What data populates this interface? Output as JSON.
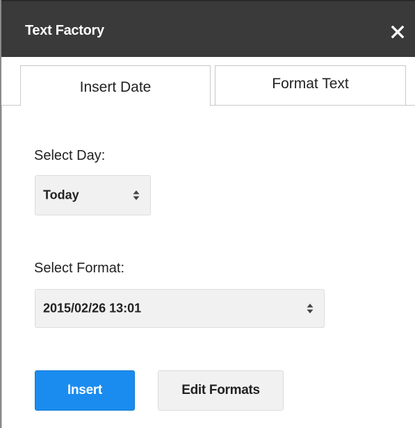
{
  "dialog": {
    "title": "Text Factory",
    "close_icon": "close-icon"
  },
  "tabs": [
    {
      "label": "Insert Date",
      "active": true
    },
    {
      "label": "Format Text",
      "active": false
    }
  ],
  "insert_date": {
    "day_label": "Select Day:",
    "day_value": "Today",
    "format_label": "Select Format:",
    "format_value": "2015/02/26 13:01"
  },
  "buttons": {
    "insert": "Insert",
    "edit_formats": "Edit Formats"
  },
  "colors": {
    "header_bg": "#3a3a3a",
    "primary_button": "#1a8cf0",
    "select_bg": "#f1f1f1"
  }
}
